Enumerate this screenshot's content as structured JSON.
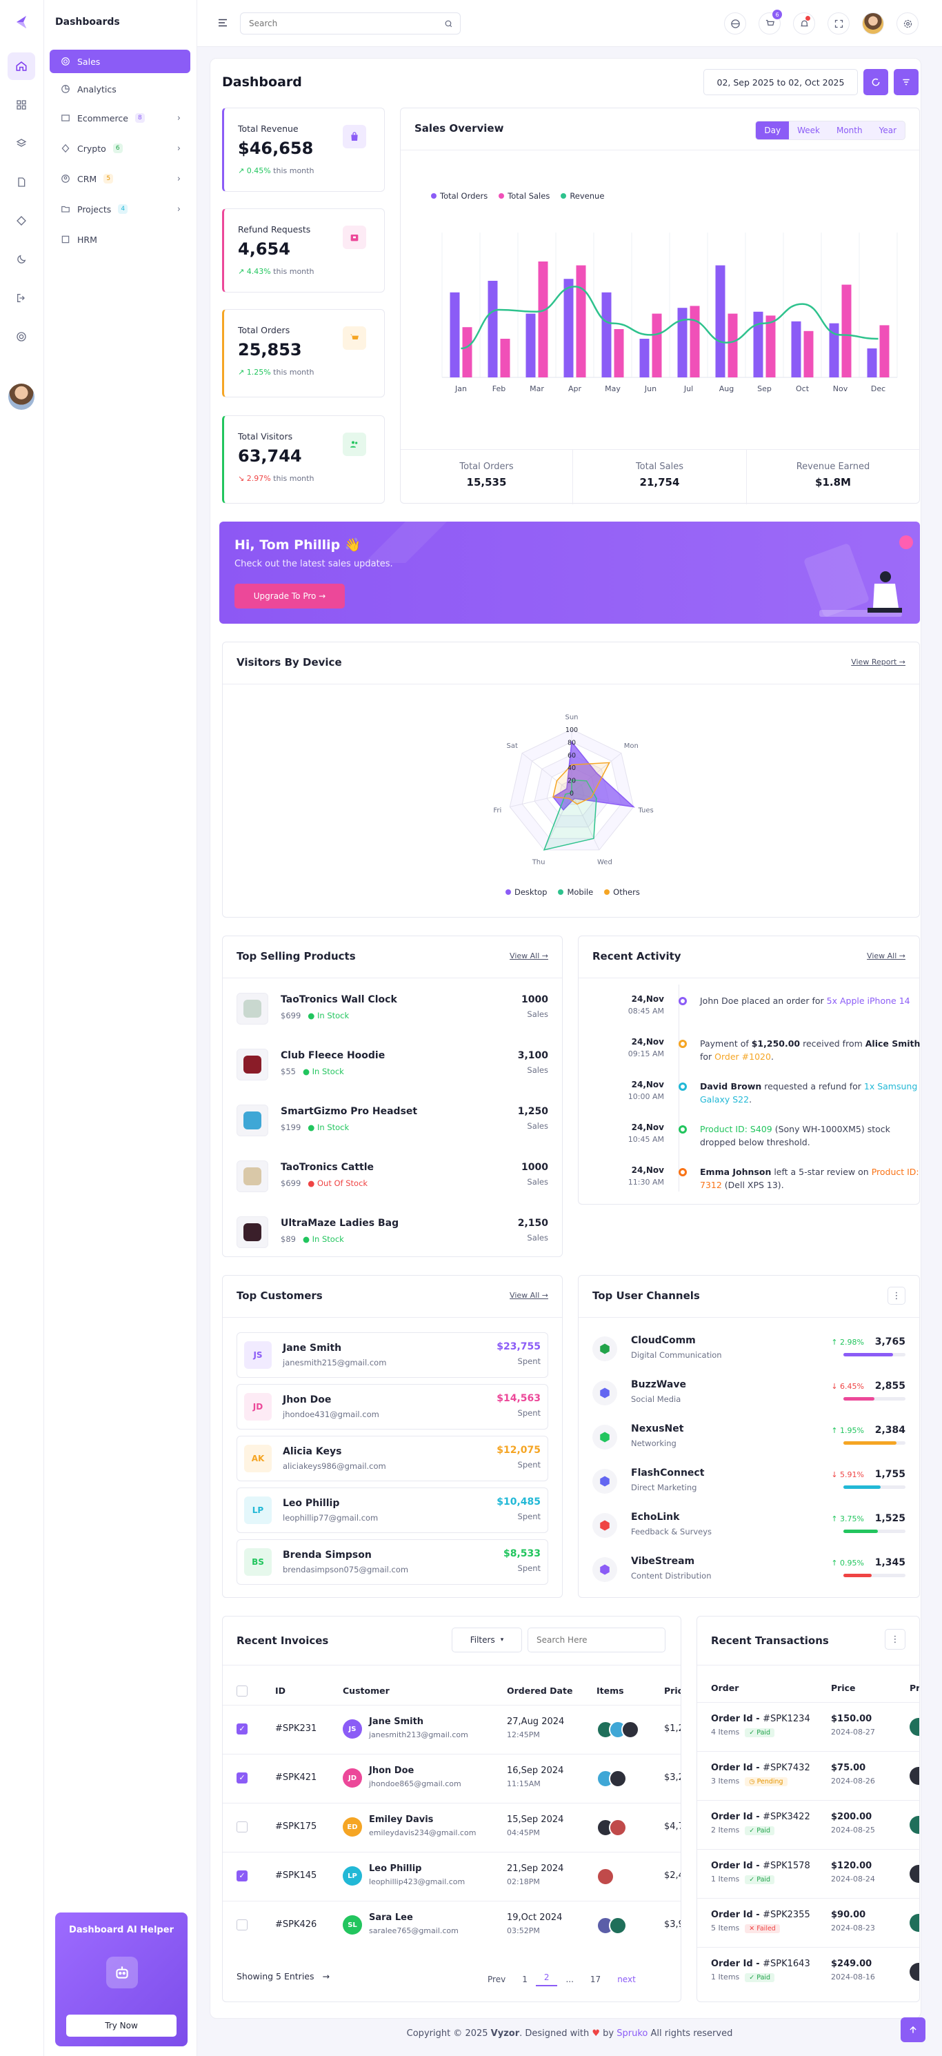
{
  "sidebar": {
    "title": "Dashboards",
    "items": [
      {
        "label": "Sales",
        "badge": ""
      },
      {
        "label": "Analytics",
        "badge": ""
      },
      {
        "label": "Ecommerce",
        "badge": "8"
      },
      {
        "label": "Crypto",
        "badge": "6"
      },
      {
        "label": "CRM",
        "badge": "5"
      },
      {
        "label": "Projects",
        "badge": "4"
      },
      {
        "label": "HRM",
        "badge": ""
      }
    ],
    "ai_helper": {
      "title": "Dashboard AI Helper",
      "button": "Try Now"
    }
  },
  "header": {
    "search_placeholder": "Search",
    "cart_count": "6"
  },
  "page": {
    "title": "Dashboard",
    "date_range": "02, Sep 2025 to 02, Oct 2025"
  },
  "stats": [
    {
      "label": "Total Revenue",
      "value": "$46,658",
      "change": "0.45%",
      "suffix": "this month",
      "direction": "up",
      "color": "#8b5cf6"
    },
    {
      "label": "Refund Requests",
      "value": "4,654",
      "change": "4.43%",
      "suffix": "this month",
      "direction": "up",
      "color": "#ec4899"
    },
    {
      "label": "Total Orders",
      "value": "25,853",
      "change": "1.25%",
      "suffix": "this month",
      "direction": "up",
      "color": "#f59e0b"
    },
    {
      "label": "Total Visitors",
      "value": "63,744",
      "change": "2.97%",
      "suffix": "this month",
      "direction": "down",
      "color": "#22c55e"
    }
  ],
  "sales_overview": {
    "title": "Sales Overview",
    "tabs": [
      "Day",
      "Week",
      "Month",
      "Year"
    ],
    "active_tab": "Day",
    "summary": [
      {
        "label": "Total Orders",
        "value": "15,535"
      },
      {
        "label": "Total Sales",
        "value": "21,754"
      },
      {
        "label": "Revenue Earned",
        "value": "$1.8M"
      }
    ]
  },
  "chart_data": [
    {
      "type": "bar",
      "categories": [
        "Jan",
        "Feb",
        "Mar",
        "Apr",
        "May",
        "Jun",
        "Jul",
        "Aug",
        "Sep",
        "Oct",
        "Nov",
        "Dec"
      ],
      "series": [
        {
          "name": "Total Orders",
          "type": "bar",
          "color": "#8b5cf6",
          "values": [
            44,
            50,
            33,
            51,
            44,
            20,
            36,
            58,
            34,
            29,
            28,
            15
          ]
        },
        {
          "name": "Total Sales",
          "type": "bar",
          "color": "#f050b8",
          "values": [
            26,
            20,
            60,
            58,
            25,
            33,
            37,
            33,
            32,
            24,
            48,
            27
          ]
        },
        {
          "name": "Revenue",
          "type": "line",
          "color": "#2ec28d",
          "values": [
            15,
            35,
            34,
            47,
            28,
            22,
            30,
            18,
            28,
            38,
            22,
            20
          ]
        }
      ],
      "ylim": [
        0,
        75
      ],
      "grid": true,
      "legend": "top-left"
    },
    {
      "type": "radar",
      "title": "Visitors By Device",
      "categories": [
        "Sun",
        "Mon",
        "Tues",
        "Wed",
        "Thu",
        "Fri",
        "Sat"
      ],
      "ticks": [
        0,
        20,
        40,
        60,
        80,
        100
      ],
      "series": [
        {
          "name": "Desktop",
          "color": "#8b5cf6",
          "values": [
            80,
            50,
            100,
            10,
            30,
            30,
            10
          ]
        },
        {
          "name": "Mobile",
          "color": "#2ec28d",
          "values": [
            20,
            30,
            40,
            80,
            100,
            10,
            0
          ]
        },
        {
          "name": "Others",
          "color": "#f5a524",
          "values": [
            44,
            76,
            32,
            20,
            10,
            30,
            30
          ]
        }
      ],
      "legend": "bottom"
    }
  ],
  "banner": {
    "title": "Hi, Tom Phillip 👋",
    "subtitle": "Check out the latest sales updates.",
    "button": "Upgrade To Pro →"
  },
  "visitors": {
    "title": "Visitors By Device",
    "link": "View Report →"
  },
  "top_products": {
    "title": "Top Selling Products",
    "link": "View All →",
    "items": [
      {
        "name": "TaoTronics Wall Clock",
        "price": "$699",
        "status": "In Stock",
        "stock": true,
        "count": "1000",
        "unit": "Sales"
      },
      {
        "name": "Club Fleece Hoodie",
        "price": "$55",
        "status": "In Stock",
        "stock": true,
        "count": "3,100",
        "unit": "Sales"
      },
      {
        "name": "SmartGizmo Pro Headset",
        "price": "$199",
        "status": "In Stock",
        "stock": true,
        "count": "1,250",
        "unit": "Sales"
      },
      {
        "name": "TaoTronics Cattle",
        "price": "$699",
        "status": "Out Of Stock",
        "stock": false,
        "count": "1000",
        "unit": "Sales"
      },
      {
        "name": "UltraMaze Ladies Bag",
        "price": "$89",
        "status": "In Stock",
        "stock": true,
        "count": "2,150",
        "unit": "Sales"
      }
    ]
  },
  "activity": {
    "title": "Recent Activity",
    "link": "View All →",
    "items": [
      {
        "date": "24,Nov",
        "time": "08:45 AM",
        "color": "#8b5cf6",
        "parts": [
          {
            "t": "John Doe placed an order for "
          },
          {
            "t": "5x Apple iPhone 14",
            "c": "#8b5cf6"
          }
        ]
      },
      {
        "date": "24,Nov",
        "time": "09:15 AM",
        "color": "#f5a524",
        "parts": [
          {
            "t": "Payment of "
          },
          {
            "t": "$1,250.00",
            "b": true
          },
          {
            "t": " received from "
          },
          {
            "t": "Alice Smith",
            "b": true
          },
          {
            "t": " for "
          },
          {
            "t": "Order #1020",
            "c": "#f5a524"
          },
          {
            "t": "."
          }
        ]
      },
      {
        "date": "24,Nov",
        "time": "10:00 AM",
        "color": "#22b8d6",
        "parts": [
          {
            "t": "David Brown",
            "b": true
          },
          {
            "t": " requested a refund for "
          },
          {
            "t": "1x Samsung Galaxy S22",
            "c": "#22b8d6"
          },
          {
            "t": "."
          }
        ]
      },
      {
        "date": "24,Nov",
        "time": "10:45 AM",
        "color": "#22c55e",
        "parts": [
          {
            "t": "Product ID: S409",
            "c": "#22c55e"
          },
          {
            "t": " (Sony WH-1000XM5) stock dropped below threshold."
          }
        ]
      },
      {
        "date": "24,Nov",
        "time": "11:30 AM",
        "color": "#f97316",
        "parts": [
          {
            "t": "Emma Johnson",
            "b": true
          },
          {
            "t": " left a 5-star review on "
          },
          {
            "t": "Product ID: 7312",
            "c": "#f97316"
          },
          {
            "t": " (Dell XPS 13)."
          }
        ]
      }
    ]
  },
  "customers": {
    "title": "Top Customers",
    "link": "View All →",
    "items": [
      {
        "initials": "JS",
        "name": "Jane Smith",
        "email": "janesmith215@gmail.com",
        "amount": "$23,755",
        "unit": "Spent",
        "color": "#8b5cf6",
        "bg": "#f1ebff"
      },
      {
        "initials": "JD",
        "name": "Jhon Doe",
        "email": "jhondoe431@gmail.com",
        "amount": "$14,563",
        "unit": "Spent",
        "color": "#ec4899",
        "bg": "#fdebf5"
      },
      {
        "initials": "AK",
        "name": "Alicia Keys",
        "email": "aliciakeys986@gmail.com",
        "amount": "$12,075",
        "unit": "Spent",
        "color": "#f5a524",
        "bg": "#fff4e2"
      },
      {
        "initials": "LP",
        "name": "Leo Phillip",
        "email": "leophillip77@gmail.com",
        "amount": "$10,485",
        "unit": "Spent",
        "color": "#22b8d6",
        "bg": "#e4f7fb"
      },
      {
        "initials": "BS",
        "name": "Brenda Simpson",
        "email": "brendasimpson075@gmail.com",
        "amount": "$8,533",
        "unit": "Spent",
        "color": "#22c55e",
        "bg": "#e6f8ec"
      }
    ]
  },
  "channels": {
    "title": "Top User Channels",
    "items": [
      {
        "name": "CloudComm",
        "sub": "Digital Communication",
        "change": "2.98%",
        "up": true,
        "value": "3,765",
        "level": 0.8,
        "color": "#8b5cf6",
        "icon_color": "#22a34a"
      },
      {
        "name": "BuzzWave",
        "sub": "Social Media",
        "change": "6.45%",
        "up": false,
        "value": "2,855",
        "level": 0.5,
        "color": "#ec4899",
        "icon_color": "#6366f1"
      },
      {
        "name": "NexusNet",
        "sub": "Networking",
        "change": "1.95%",
        "up": true,
        "value": "2,384",
        "level": 0.85,
        "color": "#f5a524",
        "icon_color": "#22c55e"
      },
      {
        "name": "FlashConnect",
        "sub": "Direct Marketing",
        "change": "5.91%",
        "up": false,
        "value": "1,755",
        "level": 0.6,
        "color": "#22b8d6",
        "icon_color": "#6366f1"
      },
      {
        "name": "EchoLink",
        "sub": "Feedback & Surveys",
        "change": "3.75%",
        "up": true,
        "value": "1,525",
        "level": 0.55,
        "color": "#22c55e",
        "icon_color": "#ef4444"
      },
      {
        "name": "VibeStream",
        "sub": "Content Distribution",
        "change": "0.95%",
        "up": true,
        "value": "1,345",
        "level": 0.45,
        "color": "#ef4444",
        "icon_color": "#8b5cf6"
      }
    ]
  },
  "invoices": {
    "title": "Recent Invoices",
    "filters": "Filters",
    "search_placeholder": "Search Here",
    "columns": [
      "ID",
      "Customer",
      "Ordered Date",
      "Items",
      "Price"
    ],
    "rows": [
      {
        "checked": true,
        "id": "#SPK231",
        "initials": "JS",
        "avatar_color": "#8b5cf6",
        "name": "Jane Smith",
        "email": "janesmith213@gmail.com",
        "date": "27,Aug 2024",
        "time": "12:45PM",
        "items": 3,
        "price": "$1,2"
      },
      {
        "checked": true,
        "id": "#SPK421",
        "initials": "JD",
        "avatar_color": "#ec4899",
        "name": "Jhon Doe",
        "email": "jhondoe865@gmail.com",
        "date": "16,Sep 2024",
        "time": "11:15AM",
        "items": 2,
        "price": "$3,2"
      },
      {
        "checked": false,
        "id": "#SPK175",
        "initials": "ED",
        "avatar_color": "#f5a524",
        "name": "Emiley Davis",
        "email": "emileydavis234@gmail.com",
        "date": "15,Sep 2024",
        "time": "04:45PM",
        "items": 2,
        "price": "$4,7"
      },
      {
        "checked": true,
        "id": "#SPK145",
        "initials": "LP",
        "avatar_color": "#22b8d6",
        "name": "Leo Phillip",
        "email": "leophillip423@gmail.com",
        "date": "21,Sep 2024",
        "time": "02:18PM",
        "items": 1,
        "price": "$2,4"
      },
      {
        "checked": false,
        "id": "#SPK426",
        "initials": "SL",
        "avatar_color": "#22c55e",
        "name": "Sara Lee",
        "email": "saralee765@gmail.com",
        "date": "19,Oct 2024",
        "time": "03:52PM",
        "items": 2,
        "price": "$3,9"
      }
    ],
    "showing": "Showing 5 Entries",
    "pager": [
      "Prev",
      "1",
      "2",
      "...",
      "17",
      "next"
    ],
    "current_page": "2"
  },
  "transactions": {
    "title": "Recent Transactions",
    "columns": [
      "Order",
      "Price",
      "Pr"
    ],
    "rows": [
      {
        "order": "Order Id - ",
        "num": "#SPK1234",
        "items": "4 Items",
        "status": "Paid",
        "price": "$150.00",
        "date": "2024-08-27"
      },
      {
        "order": "Order Id - ",
        "num": "#SPK7432",
        "items": "3 Items",
        "status": "Pending",
        "price": "$75.00",
        "date": "2024-08-26"
      },
      {
        "order": "Order Id - ",
        "num": "#SPK3422",
        "items": "2 Items",
        "status": "Paid",
        "price": "$200.00",
        "date": "2024-08-25"
      },
      {
        "order": "Order Id - ",
        "num": "#SPK1578",
        "items": "1 Items",
        "status": "Paid",
        "price": "$120.00",
        "date": "2024-08-24"
      },
      {
        "order": "Order Id - ",
        "num": "#SPK2355",
        "items": "5 Items",
        "status": "Failed",
        "price": "$90.00",
        "date": "2024-08-23"
      },
      {
        "order": "Order Id - ",
        "num": "#SPK1643",
        "items": "1 Items",
        "status": "Paid",
        "price": "$249.00",
        "date": "2024-08-16"
      }
    ]
  },
  "footer": {
    "pre": "Copyright © 2025 ",
    "brand": "Vyzor",
    "mid": ". Designed with ",
    "by": " by ",
    "maker": "Spruko",
    "post": " All rights reserved"
  }
}
